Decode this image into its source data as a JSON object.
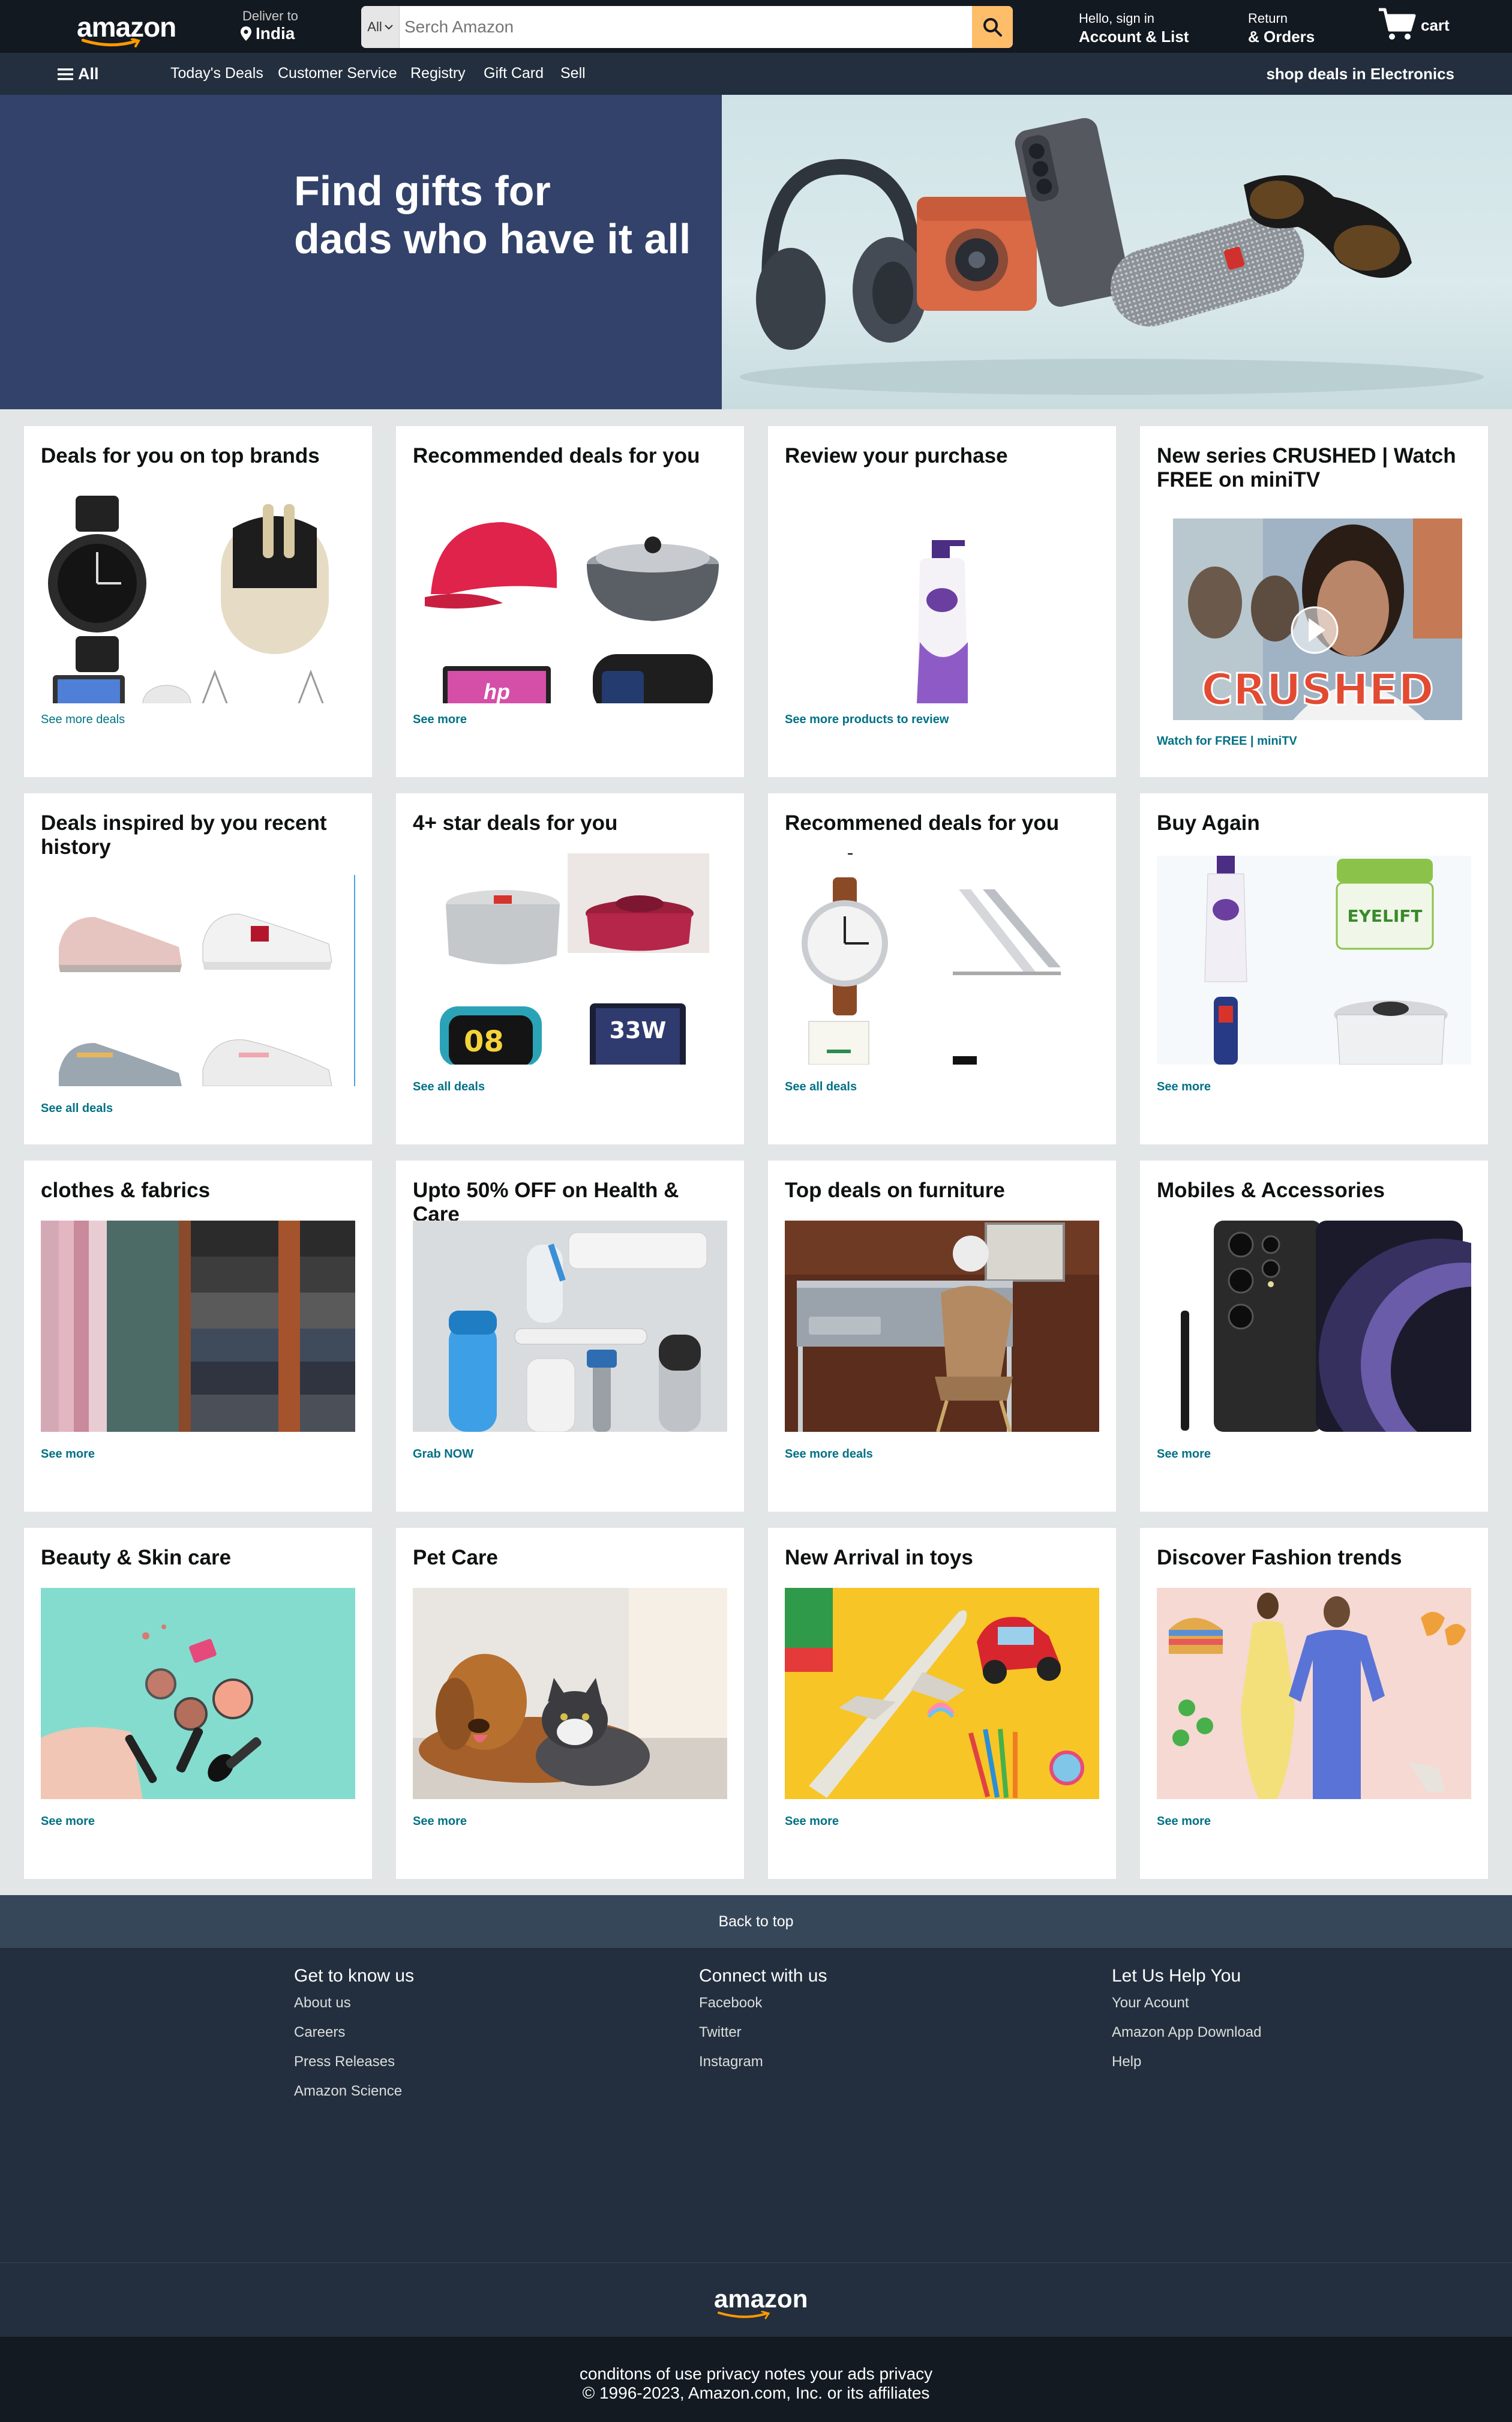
{
  "header": {
    "logo": "amazon",
    "deliver_label": "Deliver to",
    "deliver_location": "India",
    "search_category": "All",
    "search_placeholder": "Serch Amazon",
    "account_greeting": "Hello, sign in",
    "account_label": "Account & List",
    "returns_label": "Return",
    "orders_label": "& Orders",
    "cart_label": "cart"
  },
  "subnav": {
    "all_label": "All",
    "links": [
      "Today's Deals",
      "Customer Service",
      "Registry",
      "Gift Card",
      "Sell"
    ],
    "promo": "shop deals in Electronics"
  },
  "hero": {
    "title": "Find gifts for\ndads who have it all"
  },
  "cards": [
    {
      "title": "Deals for you on top brands",
      "link": "See more deals"
    },
    {
      "title": "Recommended deals for you",
      "link": "See more"
    },
    {
      "title": "Review your purchase",
      "link": "See more products to review"
    },
    {
      "title": "New series CRUSHED | Watch FREE on miniTV",
      "link": "Watch for FREE | miniTV",
      "overlay_text": "CRUSHED"
    },
    {
      "title": "Deals inspired by you recent history",
      "link": "See all deals"
    },
    {
      "title": "4+ star deals for you",
      "link": "See all deals",
      "badge_text": "33W"
    },
    {
      "title": "Recommened deals for you",
      "link": "See all deals"
    },
    {
      "title": "Buy Again",
      "link": "See more",
      "product_label": "EYELIFT"
    },
    {
      "title": "clothes & fabrics",
      "link": "See more"
    },
    {
      "title": "Upto 50% OFF on Health & Care",
      "link": "Grab NOW"
    },
    {
      "title": "Top deals on furniture",
      "link": "See more deals"
    },
    {
      "title": "Mobiles & Accessories",
      "link": "See more"
    },
    {
      "title": "Beauty & Skin care",
      "link": "See more"
    },
    {
      "title": "Pet Care",
      "link": "See more"
    },
    {
      "title": "New Arrival in toys",
      "link": "See more"
    },
    {
      "title": "Discover Fashion trends",
      "link": "See more"
    }
  ],
  "footer": {
    "back_to_top": "Back to top",
    "columns": [
      {
        "heading": "Get to know us",
        "links": [
          "About us",
          "Careers",
          "Press Releases",
          "Amazon Science"
        ]
      },
      {
        "heading": "Connect with us",
        "links": [
          "Facebook",
          "Twitter",
          "Instagram"
        ]
      },
      {
        "heading": "Let Us Help You",
        "links": [
          "Your Acount",
          "Amazon App Download",
          "Help"
        ]
      }
    ],
    "logo": "amazon",
    "legal_line1": "conditons of use privacy notes your ads privacy",
    "legal_line2": "© 1996-2023, Amazon.com, Inc. or its affiliates"
  },
  "colors": {
    "nav_bg": "#131921",
    "subnav_bg": "#232f3e",
    "search_button": "#febd69",
    "hero_bg": "#33426a",
    "link": "#007185",
    "page_bg": "#e3e6e6"
  }
}
